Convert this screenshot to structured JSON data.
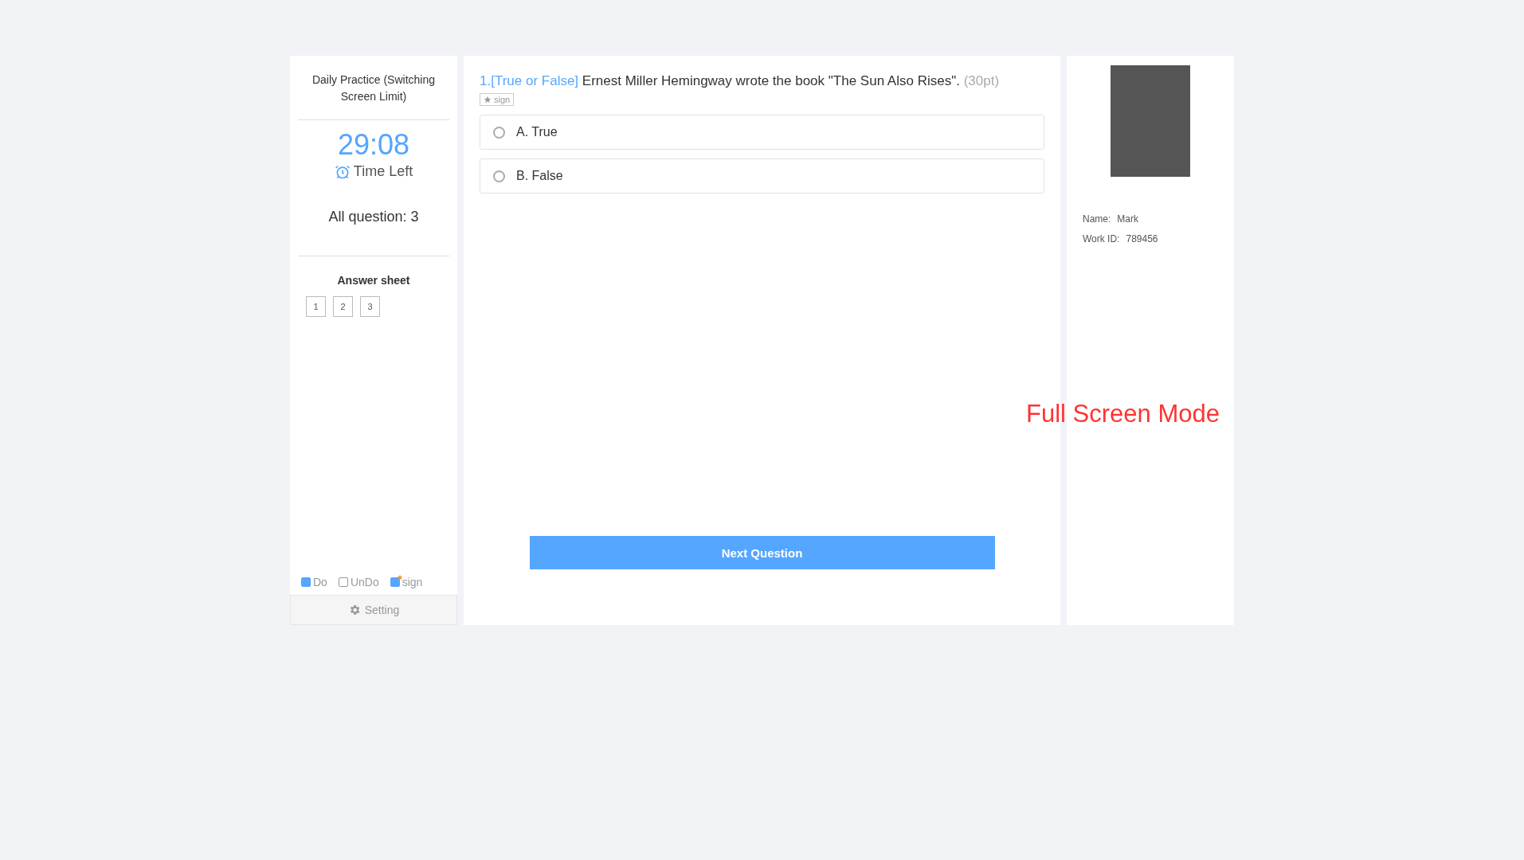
{
  "exam": {
    "title": "Daily Practice (Switching Screen Limit)",
    "timer": "29:08",
    "timer_label": "Time Left",
    "question_count": "All question: 3"
  },
  "answer_sheet": {
    "title": "Answer sheet",
    "items": [
      {
        "label": "1",
        "done": false
      },
      {
        "label": "2",
        "done": false
      },
      {
        "label": "3",
        "done": false
      }
    ]
  },
  "legend": [
    {
      "kind": "do",
      "label": "Do"
    },
    {
      "kind": "undo",
      "label": "UnDo"
    },
    {
      "kind": "sign",
      "label": "sign"
    }
  ],
  "setting": "Setting",
  "question": {
    "number": "1.",
    "type": "[True or False]",
    "text": "Ernest Miller Hemingway wrote the book \"The Sun Also Rises\".",
    "points": "(30pt)",
    "sign": "sign",
    "options": [
      {
        "label": "A. True",
        "selected": false
      },
      {
        "label": "B. False",
        "selected": false
      }
    ]
  },
  "next_button": "Next Question",
  "profile": {
    "name_label": "Name:",
    "name": "Mark",
    "id_label": "Work ID:",
    "id": "789456"
  },
  "overlay": "Full Screen Mode"
}
